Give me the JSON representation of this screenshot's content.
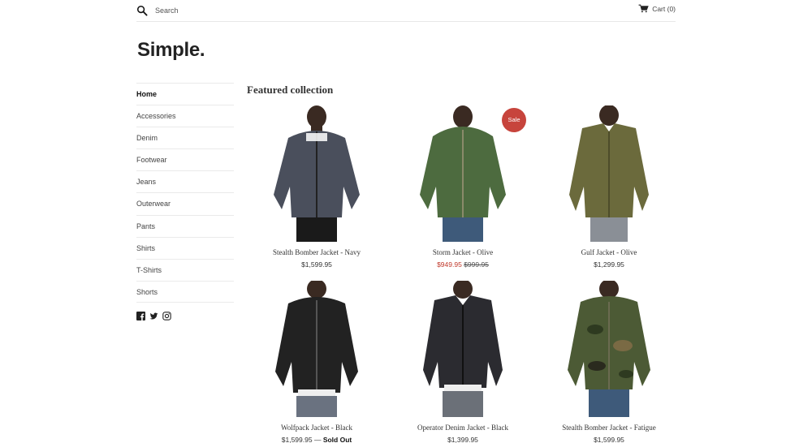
{
  "header": {
    "search_placeholder": "Search",
    "cart_label": "Cart (0)"
  },
  "logo": "Simple.",
  "sidebar": {
    "items": [
      {
        "label": "Home",
        "active": true
      },
      {
        "label": "Accessories"
      },
      {
        "label": "Denim"
      },
      {
        "label": "Footwear"
      },
      {
        "label": "Jeans"
      },
      {
        "label": "Outerwear"
      },
      {
        "label": "Pants"
      },
      {
        "label": "Shirts"
      },
      {
        "label": "T-Shirts"
      },
      {
        "label": "Shorts"
      }
    ],
    "social": [
      "facebook-icon",
      "twitter-icon",
      "instagram-icon"
    ]
  },
  "main": {
    "title": "Featured collection",
    "products": [
      {
        "name": "Stealth Bomber Jacket - Navy",
        "price": "$1,599.95",
        "jacket_color": "#4a4f5c"
      },
      {
        "name": "Storm Jacket - Olive",
        "sale_price": "$949.95",
        "compare_price": "$999.95",
        "badge": "Sale",
        "jacket_color": "#4d6b3f"
      },
      {
        "name": "Gulf Jacket - Olive",
        "price": "$1,299.95",
        "jacket_color": "#6b6a3c"
      },
      {
        "name": "Wolfpack Jacket - Black",
        "price": "$1,599.95",
        "sold_out_sep": " — ",
        "sold_out": "Sold Out",
        "jacket_color": "#222222"
      },
      {
        "name": "Operator Denim Jacket - Black",
        "price": "$1,399.95",
        "jacket_color": "#2b2b30"
      },
      {
        "name": "Stealth Bomber Jacket - Fatigue",
        "price": "$1,599.95",
        "jacket_color": "#4c5a35"
      }
    ]
  },
  "colors": {
    "sale": "#c0392b",
    "badge": "#c7443c"
  }
}
